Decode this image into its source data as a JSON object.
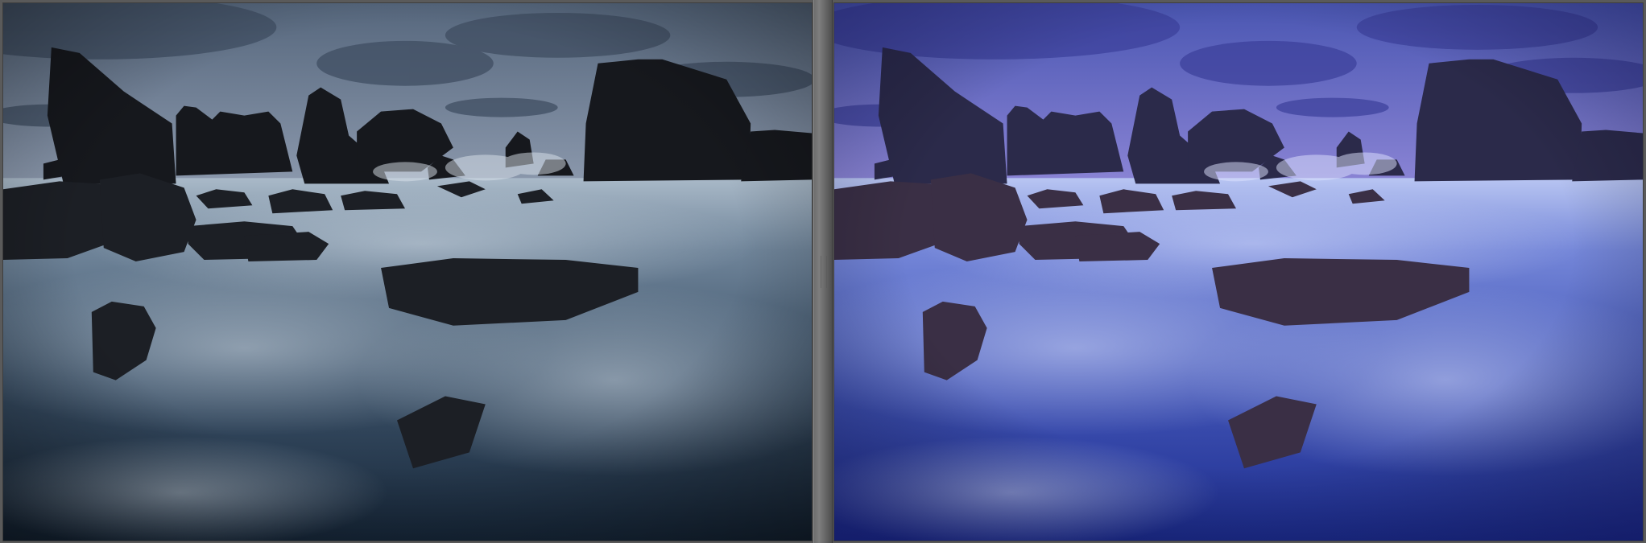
{
  "viewer": {
    "mode": "before-after-side-by-side",
    "panels": [
      {
        "id": "before",
        "image": "seascape-rocks-long-exposure-original",
        "palette": {
          "sky_top": "#5b6b80",
          "sky_bottom": "#c9d1da",
          "water_dark": "#142437",
          "water_light": "#b8c6d4",
          "rock": "#15171c"
        }
      },
      {
        "id": "after",
        "image": "seascape-rocks-long-exposure-edited",
        "palette": {
          "sky_top": "#4b57b3",
          "sky_bottom": "#e7b9f2",
          "water_dark": "#20339a",
          "water_light": "#b7c2f4",
          "rock": "#2a2947"
        }
      }
    ],
    "divider_color": "#6f6f6f"
  }
}
